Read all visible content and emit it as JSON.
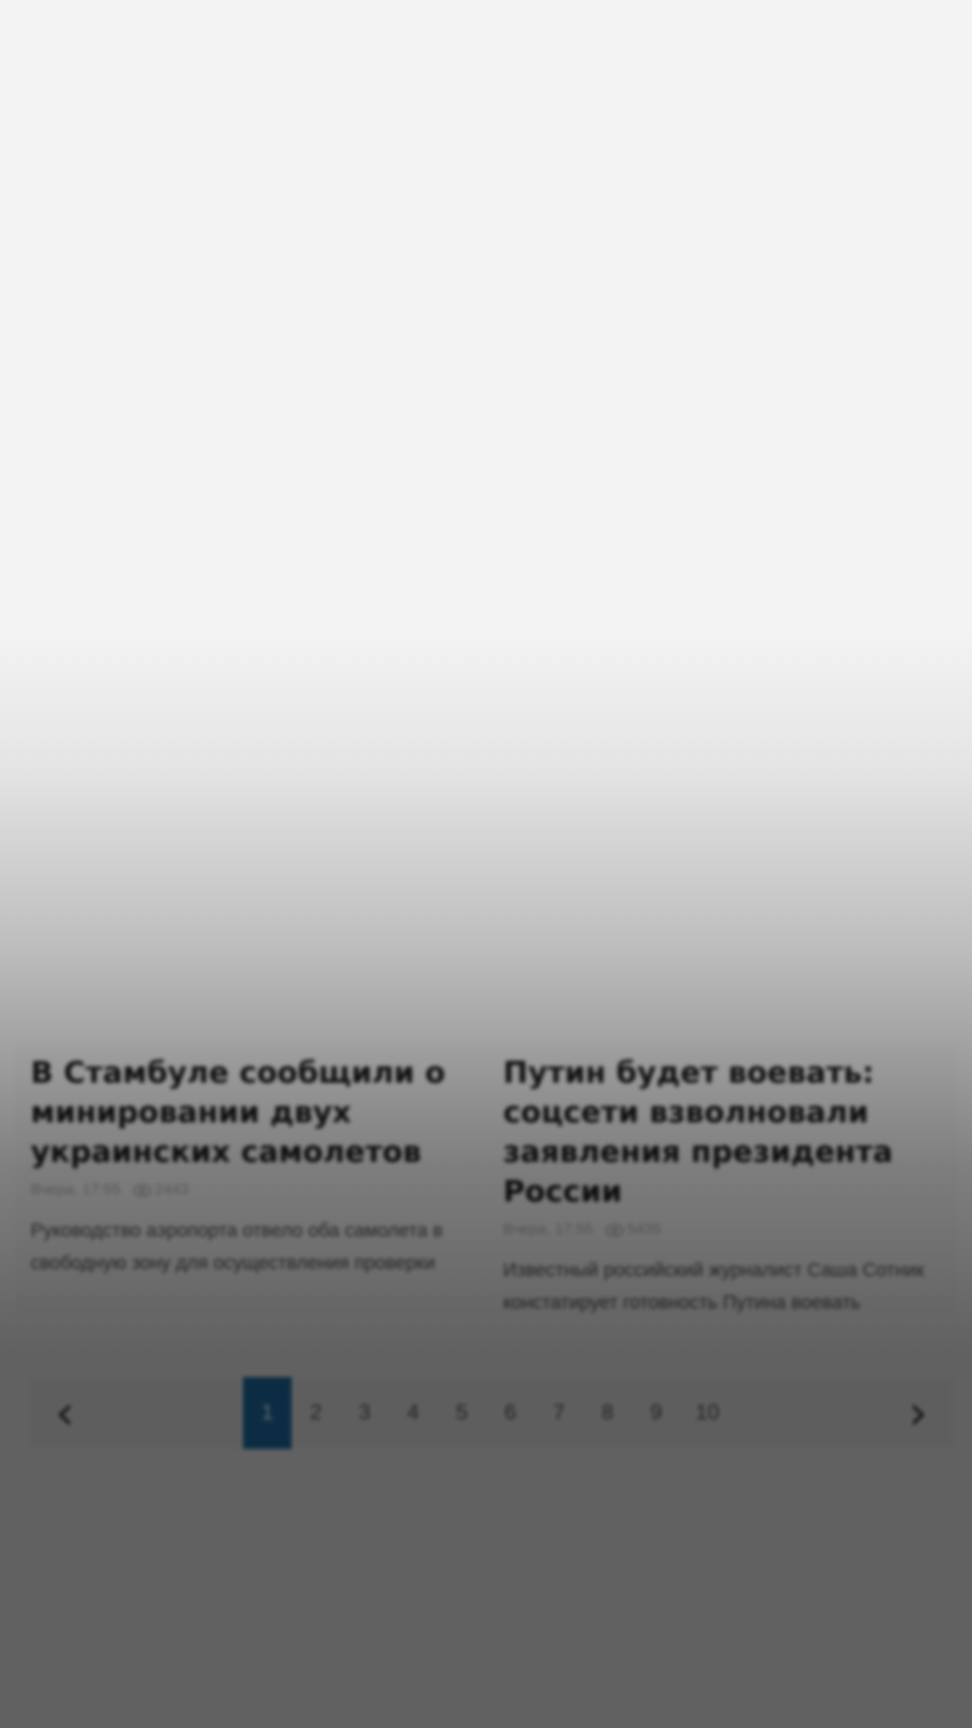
{
  "articles": [
    {
      "title": "В Стамбуле сообщили о минировании двух украинских самолетов",
      "date": "Вчера, 17:55",
      "views": "2443",
      "description": "Руководство аэропорта отвело оба самолета в свободную зону для осуществления проверки"
    },
    {
      "title": "Путин будет воевать: соцсети взволновали заявления президента России",
      "date": "Вчера, 17:55",
      "views": "5435",
      "description": "Известный российский журналист Саша Сотник констатирует готовность Путина воевать"
    }
  ],
  "pagination": {
    "prev_icon": "chevron-left-icon",
    "next_icon": "chevron-right-icon",
    "prev_glyph": "‹",
    "next_glyph": "›",
    "pages": [
      "1",
      "2",
      "3",
      "4",
      "5",
      "6",
      "7",
      "8",
      "9",
      "10"
    ],
    "active_page": "1",
    "active_color": "#1e6fa8"
  }
}
